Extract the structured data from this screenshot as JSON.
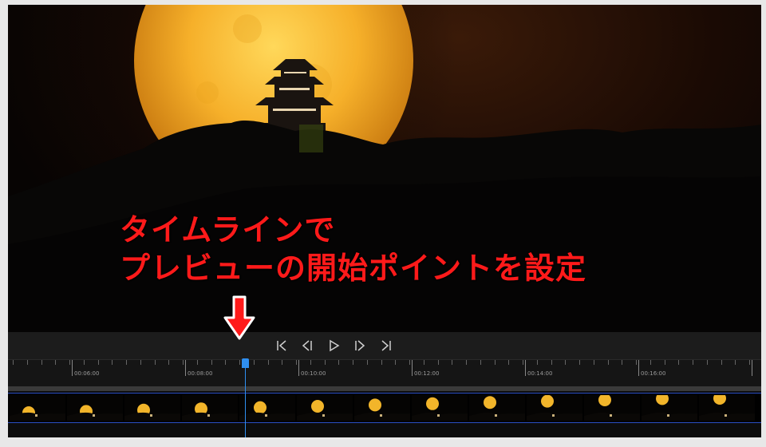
{
  "annotation": {
    "line1": "タイムラインで",
    "line2": "プレビューの開始ポイントを設定",
    "color": "#ff1a1a"
  },
  "player": {
    "controls": [
      "skip-to-start-icon",
      "previous-frame-icon",
      "play-icon",
      "next-frame-icon",
      "skip-to-end-icon"
    ]
  },
  "timeline": {
    "labels": [
      "00:06:00",
      "00:08:00",
      "00:10:00",
      "00:12:00",
      "00:14:00",
      "00:16:00"
    ],
    "accent": "#2f8ff0",
    "track_border": "#2b4fc4"
  }
}
